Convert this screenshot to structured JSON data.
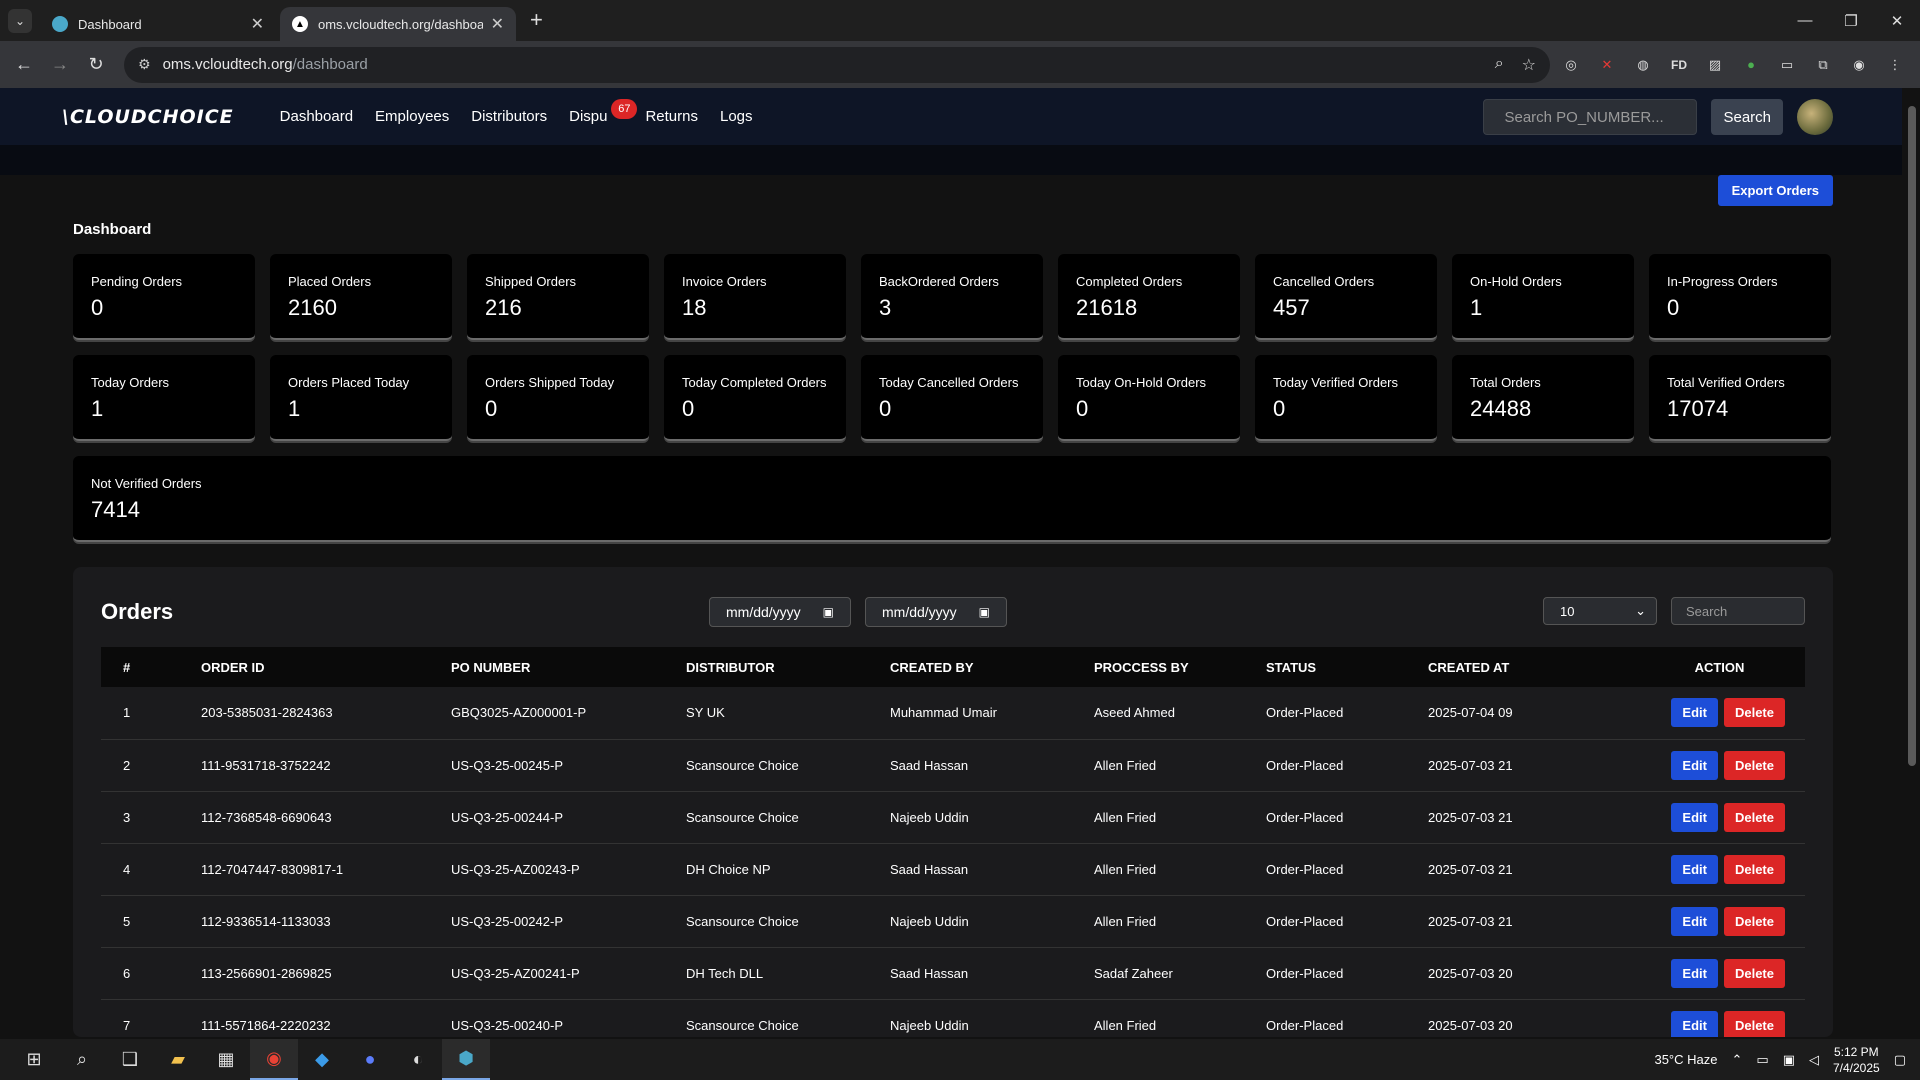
{
  "browser": {
    "tabs": [
      {
        "title": "Dashboard",
        "active": false
      },
      {
        "title": "oms.vcloudtech.org/dashboard",
        "active": true
      }
    ],
    "url_host": "oms.vcloudtech.org",
    "url_path": "/dashboard"
  },
  "nav": {
    "logo": "\\CLOUDCHOICE",
    "links": [
      "Dashboard",
      "Employees",
      "Distributors",
      "Dispu",
      "Returns",
      "Logs"
    ],
    "dispute_badge": "67",
    "search_placeholder": "Search PO_NUMBER...",
    "search_button": "Search"
  },
  "main": {
    "export_button": "Export Orders",
    "page_title": "Dashboard",
    "stats": [
      {
        "label": "Pending Orders",
        "value": "0"
      },
      {
        "label": "Placed Orders",
        "value": "2160"
      },
      {
        "label": "Shipped Orders",
        "value": "216"
      },
      {
        "label": "Invoice Orders",
        "value": "18"
      },
      {
        "label": "BackOrdered Orders",
        "value": "3"
      },
      {
        "label": "Completed Orders",
        "value": "21618"
      },
      {
        "label": "Cancelled Orders",
        "value": "457"
      },
      {
        "label": "On-Hold Orders",
        "value": "1"
      },
      {
        "label": "In-Progress Orders",
        "value": "0"
      },
      {
        "label": "Today Orders",
        "value": "1"
      },
      {
        "label": "Orders Placed Today",
        "value": "1"
      },
      {
        "label": "Orders Shipped Today",
        "value": "0"
      },
      {
        "label": "Today Completed Orders",
        "value": "0"
      },
      {
        "label": "Today Cancelled Orders",
        "value": "0"
      },
      {
        "label": "Today On-Hold Orders",
        "value": "0"
      },
      {
        "label": "Today Verified Orders",
        "value": "0"
      },
      {
        "label": "Total Orders",
        "value": "24488"
      },
      {
        "label": "Total Verified Orders",
        "value": "17074"
      },
      {
        "label": "Not Verified Orders",
        "value": "7414"
      }
    ]
  },
  "orders": {
    "title": "Orders",
    "date_from_placeholder": "mm/dd/yyyy",
    "date_to_placeholder": "mm/dd/yyyy",
    "per_page": "10",
    "search_placeholder": "Search",
    "columns": [
      "#",
      "ORDER ID",
      "PO NUMBER",
      "DISTRIBUTOR",
      "CREATED BY",
      "PROCCESS BY",
      "STATUS",
      "CREATED AT",
      "ACTION"
    ],
    "edit_label": "Edit",
    "delete_label": "Delete",
    "rows": [
      [
        "1",
        "203-5385031-2824363",
        "GBQ3025-AZ000001-P",
        "SY UK",
        "Muhammad Umair",
        "Aseed Ahmed",
        "Order-Placed",
        "2025-07-04 09"
      ],
      [
        "2",
        "111-9531718-3752242",
        "US-Q3-25-00245-P",
        "Scansource Choice",
        "Saad Hassan",
        "Allen Fried",
        "Order-Placed",
        "2025-07-03 21"
      ],
      [
        "3",
        "112-7368548-6690643",
        "US-Q3-25-00244-P",
        "Scansource Choice",
        "Najeeb Uddin",
        "Allen Fried",
        "Order-Placed",
        "2025-07-03 21"
      ],
      [
        "4",
        "112-7047447-8309817-1",
        "US-Q3-25-AZ00243-P",
        "DH Choice NP",
        "Saad Hassan",
        "Allen Fried",
        "Order-Placed",
        "2025-07-03 21"
      ],
      [
        "5",
        "112-9336514-1133033",
        "US-Q3-25-00242-P",
        "Scansource Choice",
        "Najeeb Uddin",
        "Allen Fried",
        "Order-Placed",
        "2025-07-03 21"
      ],
      [
        "6",
        "113-2566901-2869825",
        "US-Q3-25-AZ00241-P",
        "DH Tech DLL",
        "Saad Hassan",
        "Sadaf Zaheer",
        "Order-Placed",
        "2025-07-03 20"
      ],
      [
        "7",
        "111-5571864-2220232",
        "US-Q3-25-00240-P",
        "Scansource Choice",
        "Najeeb Uddin",
        "Allen Fried",
        "Order-Placed",
        "2025-07-03 20"
      ]
    ]
  },
  "taskbar": {
    "weather": "35°C  Haze",
    "time": "5:12 PM",
    "date": "7/4/2025"
  },
  "colors": {
    "primary": "#1d4ed8",
    "danger": "#dc2626",
    "nav_bg": "#0e1526"
  }
}
